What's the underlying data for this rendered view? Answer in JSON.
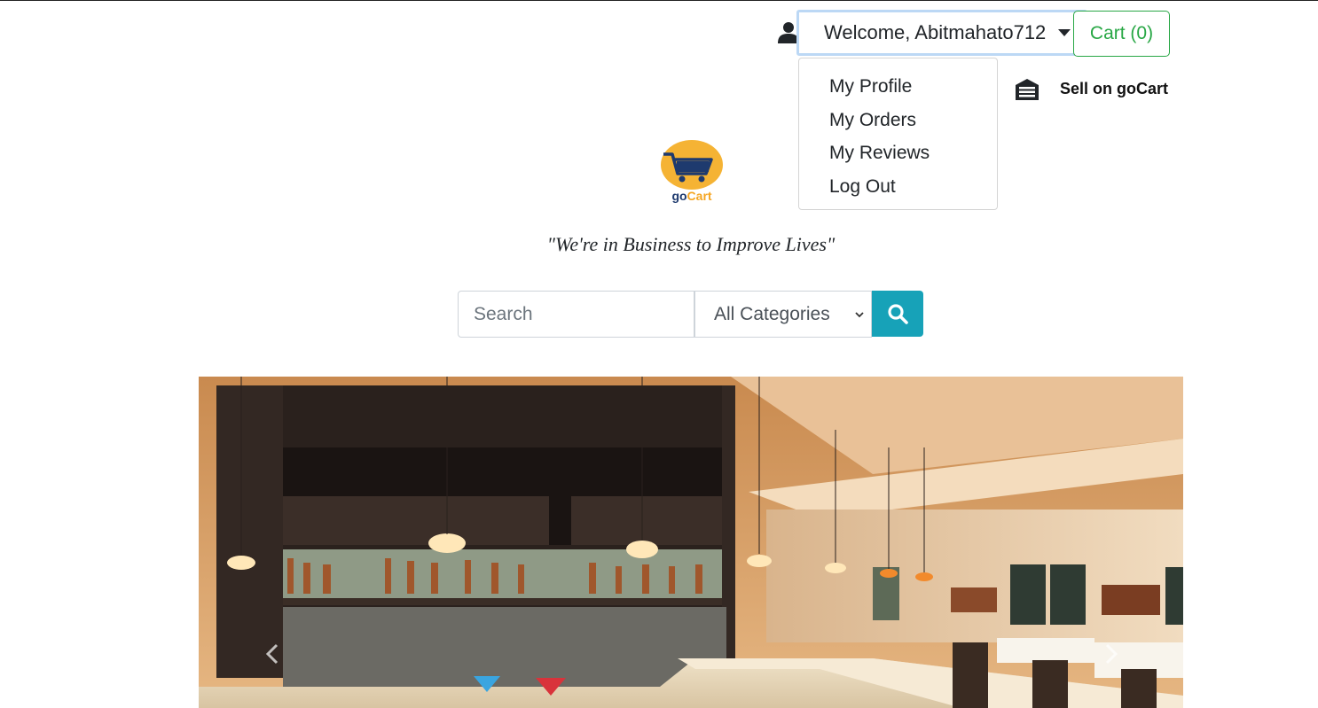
{
  "header": {
    "welcome_text": "Welcome, Abitmahato712",
    "cart_label": "Cart (0)",
    "sell_label": "Sell on goCart"
  },
  "user_menu": {
    "items": [
      {
        "label": "My Profile"
      },
      {
        "label": "My Orders"
      },
      {
        "label": "My Reviews"
      },
      {
        "label": "Log Out"
      }
    ]
  },
  "brand": {
    "logo_text": "goCart",
    "tagline": "\"We're in Business to Improve Lives\""
  },
  "search": {
    "placeholder": "Search",
    "category_selected": "All Categories"
  },
  "colors": {
    "accent_green": "#28a745",
    "search_button": "#17a2b8",
    "logo_orange": "#f5b334",
    "logo_navy": "#1e3a6e"
  },
  "icons": {
    "user": "user-icon",
    "sell": "store-icon",
    "search": "search-icon",
    "prev": "chevron-left-icon",
    "next": "chevron-right-icon"
  }
}
